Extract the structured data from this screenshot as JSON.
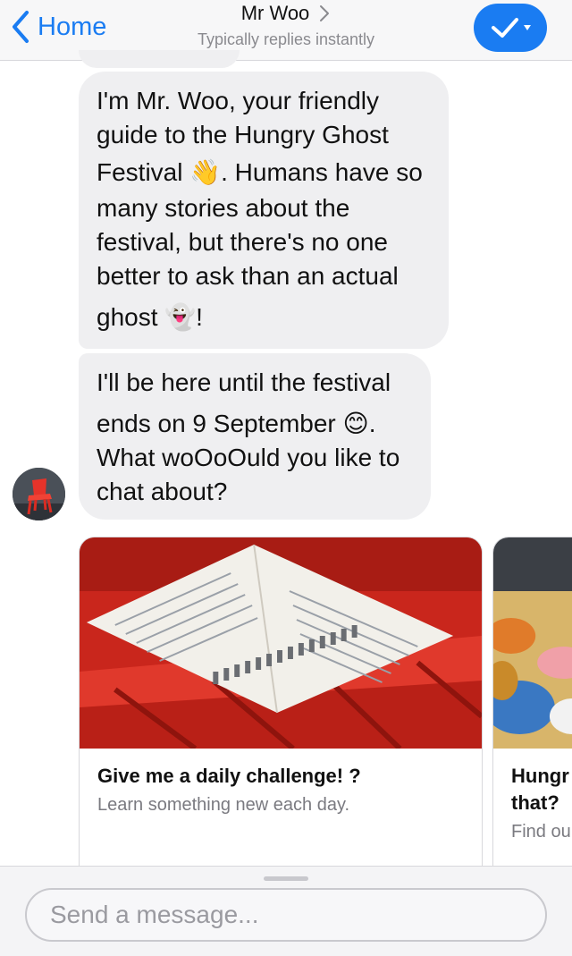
{
  "header": {
    "back_label": "Home",
    "title": "Mr Woo",
    "subtitle": "Typically replies instantly",
    "accent": "#1a7cf2"
  },
  "messages": [
    {
      "lines": [
        "I'm Mr. Woo, your friendly",
        "guide to the Hungry Ghost",
        "Festival 👋. Humans have so",
        "many stories about the",
        "festival, but there's no one",
        "better to ask than an actual",
        "ghost 👻!"
      ]
    },
    {
      "lines": [
        "I'll be here until the festival",
        "ends on 9 September 😊.",
        "What woOoOuld you like to",
        "chat about?"
      ]
    }
  ],
  "cards": [
    {
      "title": "Give me a daily challenge! ?",
      "subtitle": "Learn something new each day.",
      "image": "notebook-on-red-stool"
    },
    {
      "title_line1": "Hungr",
      "title_line2": "that?",
      "subtitle": "Find ou",
      "image": "festival-food-offerings"
    }
  ],
  "composer": {
    "placeholder": "Send a message..."
  }
}
